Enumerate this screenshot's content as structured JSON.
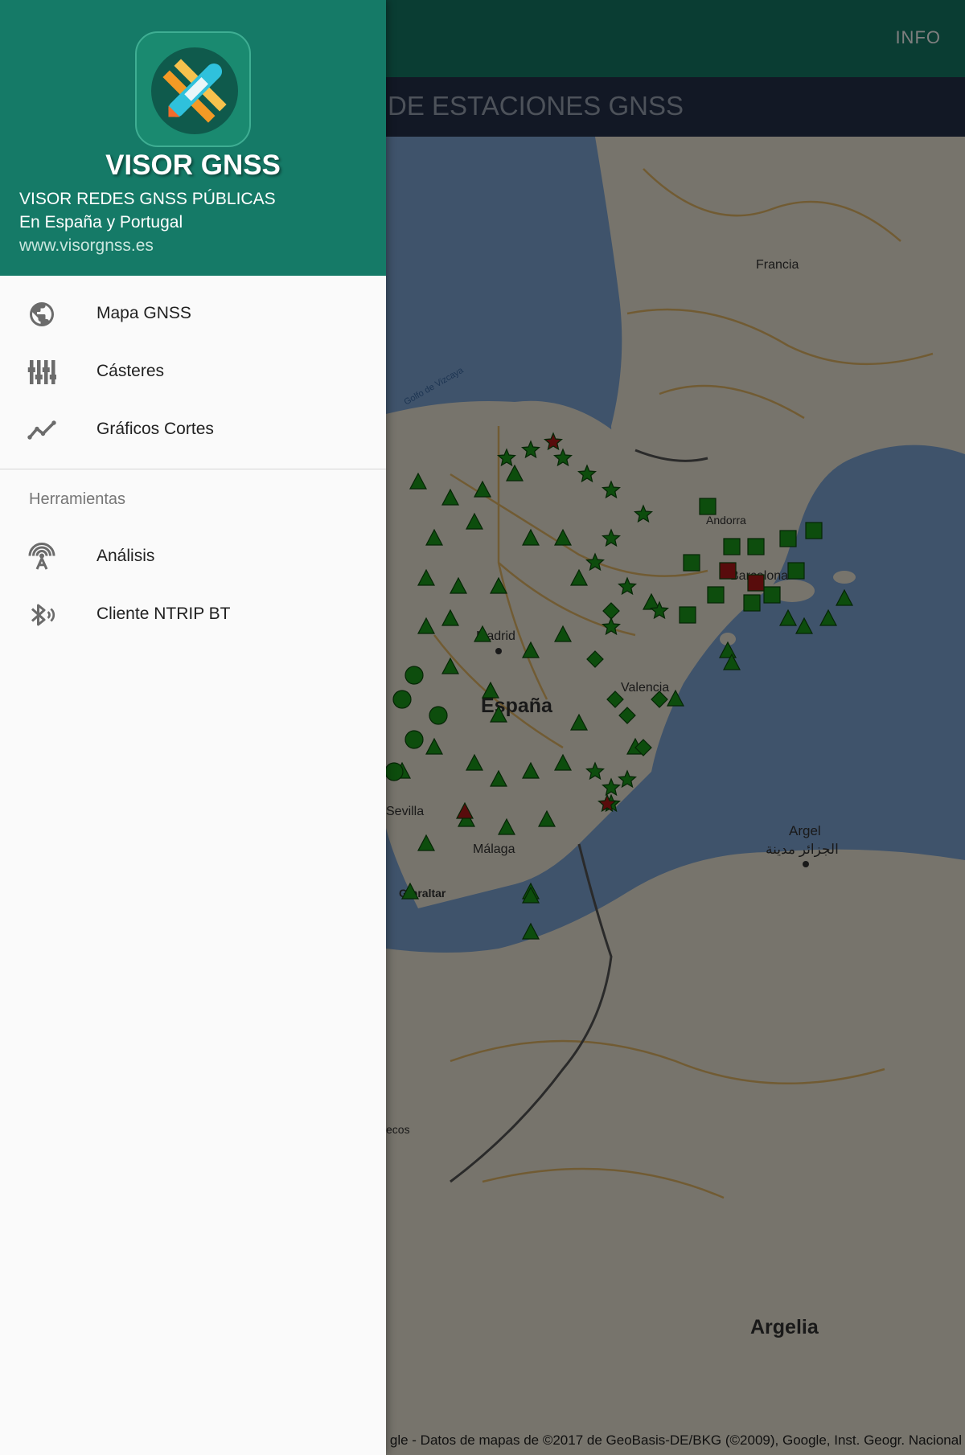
{
  "app_bar": {
    "info_label": "INFO",
    "subtitle": "DE ESTACIONES GNSS"
  },
  "map": {
    "labels": {
      "francia": "Francia",
      "golfo": "Golfo de Vizcaya",
      "madrid": "Madrid",
      "espana": "España",
      "valencia": "Valencia",
      "barcelona": "Barcelona",
      "andorra": "Andorra",
      "sevilla": "Sevilla",
      "malaga": "Málaga",
      "gibraltar": "Gibraltar",
      "argel": "Argel",
      "argel_ar": "الجزائر مدينة",
      "marruecos": "ecos",
      "argelia": "Argelia"
    },
    "credit": "gle - Datos de mapas de ©2017 de GeoBasis-DE/BKG (©2009), Google, Inst. Geogr. Nacional",
    "colors": {
      "station": "#1b9a1b",
      "alert": "#b01818",
      "sea": "#7fa6d6",
      "land": "#efe9d8"
    }
  },
  "drawer": {
    "app_name": "VISOR GNSS",
    "header_lines": [
      "VISOR REDES GNSS PÚBLICAS",
      "En España y Portugal",
      "www.visorgnss.es"
    ],
    "primary_items": [
      {
        "label": "Mapa GNSS",
        "icon": "globe-icon"
      },
      {
        "label": "Cásteres",
        "icon": "equalizer-icon"
      },
      {
        "label": "Gráficos Cortes",
        "icon": "trending-line-icon"
      }
    ],
    "section_title": "Herramientas",
    "tool_items": [
      {
        "label": "Análisis",
        "icon": "antenna-icon"
      },
      {
        "label": "Cliente NTRIP BT",
        "icon": "bluetooth-audio-icon"
      }
    ]
  }
}
